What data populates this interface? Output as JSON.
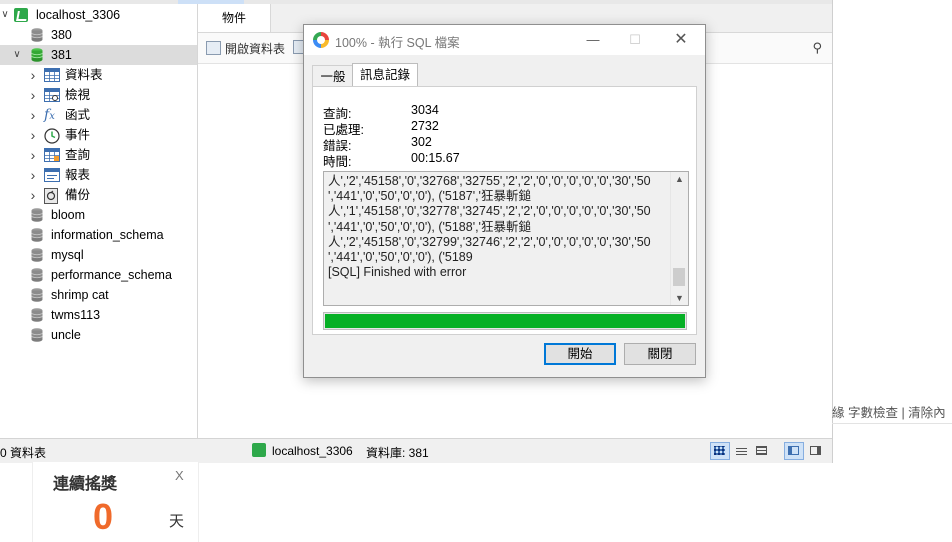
{
  "tree": {
    "items": [
      {
        "label": "localhost_3306",
        "icon": "connection-icon",
        "level": 0
      },
      {
        "label": "380",
        "icon": "database-icon",
        "level": 1
      },
      {
        "label": "381",
        "icon": "database-open-icon",
        "level": 1,
        "expanded": true,
        "selected": true
      },
      {
        "label": "資料表",
        "icon": "table-icon",
        "level": 2
      },
      {
        "label": "檢視",
        "icon": "view-icon",
        "level": 2
      },
      {
        "label": "函式",
        "icon": "function-icon",
        "level": 2
      },
      {
        "label": "事件",
        "icon": "event-clock-icon",
        "level": 2
      },
      {
        "label": "查詢",
        "icon": "query-icon",
        "level": 2
      },
      {
        "label": "報表",
        "icon": "report-icon",
        "level": 2
      },
      {
        "label": "備份",
        "icon": "backup-icon",
        "level": 2
      },
      {
        "label": "bloom",
        "icon": "database-icon",
        "level": 1
      },
      {
        "label": "information_schema",
        "icon": "database-icon",
        "level": 1
      },
      {
        "label": "mysql",
        "icon": "database-icon",
        "level": 1
      },
      {
        "label": "performance_schema",
        "icon": "database-icon",
        "level": 1
      },
      {
        "label": "shrimp cat",
        "icon": "database-icon",
        "level": 1
      },
      {
        "label": "twms113",
        "icon": "database-icon",
        "level": 1
      },
      {
        "label": "uncle",
        "icon": "database-icon",
        "level": 1
      }
    ]
  },
  "tabs": {
    "objects": "物件"
  },
  "toolbar": {
    "open_table": "開啟資料表"
  },
  "status": {
    "left": "0 資料表",
    "connection": "localhost_3306",
    "database": "資料庫: 381"
  },
  "background": {
    "browser_text": "緣   字數檢查 | 清除內",
    "widget_title": "連續搖獎",
    "widget_close": "X",
    "widget_count": "0",
    "widget_unit": "天"
  },
  "dialog": {
    "title": "100% - 執行 SQL 檔案",
    "tabs": [
      "一般",
      "訊息記錄"
    ],
    "active_tab": "訊息記錄",
    "stats": [
      {
        "label": "查詢:",
        "value": "3034"
      },
      {
        "label": "已處理:",
        "value": "2732"
      },
      {
        "label": "錯誤:",
        "value": "302"
      },
      {
        "label": "時間:",
        "value": "00:15.67"
      }
    ],
    "log_text": "人','2','45158','0','32768','32755','2','2','0','0','0','0','0','30','50\n','441','0','50','0','0'), ('5187','狂暴斬鎚\n人','1','45158','0','32778','32745','2','2','0','0','0','0','0','30','50\n','441','0','50','0','0'), ('5188','狂暴斬鎚\n人','2','45158','0','32799','32746','2','2','0','0','0','0','0','30','50\n','441','0','50','0','0'), ('5189\n[SQL] Finished with error",
    "progress": 1.0,
    "progress_color": "#06b025",
    "buttons": {
      "start": "開始",
      "close": "關閉"
    }
  }
}
